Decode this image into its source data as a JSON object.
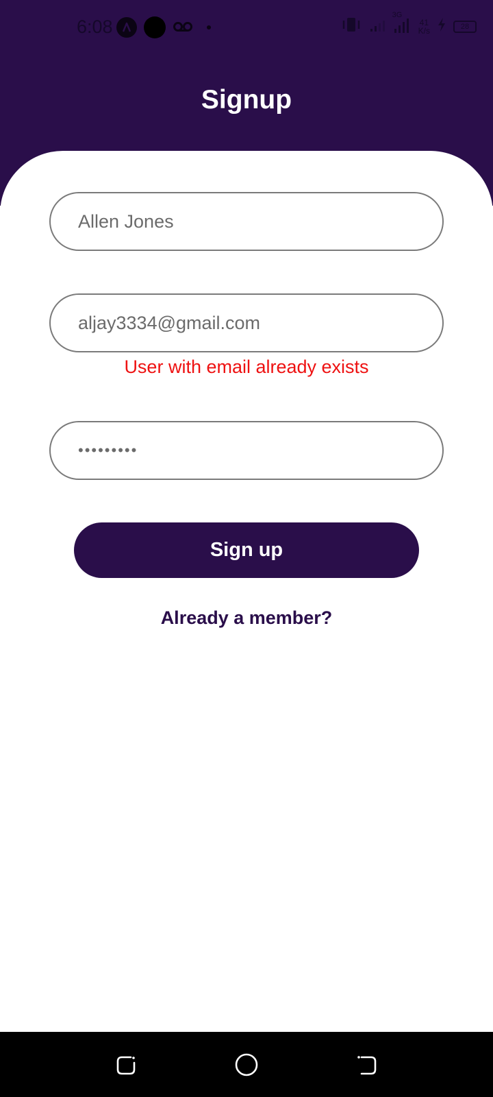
{
  "colors": {
    "brand": "#2a0e4a",
    "error": "#ee1111",
    "field_border": "#7a7a7a"
  },
  "status_bar": {
    "time": "6:08",
    "network_speed_value": "41",
    "network_speed_unit": "K/s",
    "signal_label": "3G",
    "battery": "28",
    "left_icons": [
      "app-a-icon",
      "black-circle-icon",
      "voicemail-icon",
      "dot-icon"
    ],
    "right_icons": [
      "vibrate-icon",
      "signal-weak-icon",
      "signal-icon",
      "charging-icon",
      "battery-icon"
    ]
  },
  "header": {
    "title": "Signup"
  },
  "form": {
    "name": {
      "value": "Allen Jones"
    },
    "email": {
      "value": "aljay3334@gmail.com"
    },
    "email_error": "User with email already exists",
    "password": {
      "value": "•••••••••"
    },
    "submit_label": "Sign up",
    "login_link": "Already a member?"
  },
  "nav_bar": {
    "icons": [
      "recent-apps-icon",
      "home-icon",
      "back-icon"
    ]
  }
}
